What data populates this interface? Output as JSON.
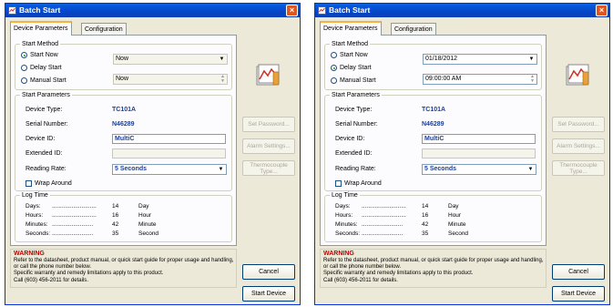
{
  "windows": [
    {
      "title": "Batch Start",
      "close_glyph": "×",
      "tabs": [
        "Device Parameters",
        "Configuration"
      ],
      "start_method": {
        "title": "Start Method",
        "options": [
          "Start Now",
          "Delay Start",
          "Manual Start"
        ],
        "selected": 0,
        "combo_value": "Now",
        "time_value": "Now"
      },
      "start_params": {
        "title": "Start Parameters",
        "device_type_label": "Device Type:",
        "device_type": "TC101A",
        "serial_label": "Serial Number:",
        "serial": "N46289",
        "device_id_label": "Device ID:",
        "device_id": "MultiC",
        "ext_id_label": "Extended ID:",
        "ext_id": "",
        "rate_label": "Reading Rate:",
        "rate": "5 Seconds",
        "wrap_label": "Wrap Around"
      },
      "log_time": {
        "title": "Log Time",
        "rows": [
          {
            "label": "Days:",
            "dots": "...........................",
            "value": "14",
            "unit": "Day"
          },
          {
            "label": "Hours:",
            "dots": "...........................",
            "value": "16",
            "unit": "Hour"
          },
          {
            "label": "Minutes:",
            "dots": ".........................",
            "value": "42",
            "unit": "Minute"
          },
          {
            "label": "Seconds:",
            "dots": ".........................",
            "value": "35",
            "unit": "Second"
          }
        ]
      },
      "side_buttons": [
        "Set Password...",
        "Alarm Settings...",
        "Thermocouple Type..."
      ],
      "warning_title": "WARNING",
      "warning_text": "Refer to the datasheet, product manual, or quick start guide for proper usage and handling, or call the phone number below.\nSpecific warranty and remedy limitations apply to this product.\nCall (603) 456-2011 for details.",
      "cancel": "Cancel",
      "start_device": "Start Device"
    },
    {
      "title": "Batch Start",
      "close_glyph": "×",
      "tabs": [
        "Device Parameters",
        "Configuration"
      ],
      "start_method": {
        "title": "Start Method",
        "options": [
          "Start Now",
          "Delay Start",
          "Manual Start"
        ],
        "selected": 1,
        "combo_value": "01/18/2012",
        "time_value": "09:00:00 AM"
      },
      "start_params": {
        "title": "Start Parameters",
        "device_type_label": "Device Type:",
        "device_type": "TC101A",
        "serial_label": "Serial Number:",
        "serial": "N46289",
        "device_id_label": "Device ID:",
        "device_id": "MultiC",
        "ext_id_label": "Extended ID:",
        "ext_id": "",
        "rate_label": "Reading Rate:",
        "rate": "5 Seconds",
        "wrap_label": "Wrap Around"
      },
      "log_time": {
        "title": "Log Time",
        "rows": [
          {
            "label": "Days:",
            "dots": "...........................",
            "value": "14",
            "unit": "Day"
          },
          {
            "label": "Hours:",
            "dots": "...........................",
            "value": "16",
            "unit": "Hour"
          },
          {
            "label": "Minutes:",
            "dots": ".........................",
            "value": "42",
            "unit": "Minute"
          },
          {
            "label": "Seconds:",
            "dots": ".........................",
            "value": "35",
            "unit": "Second"
          }
        ]
      },
      "side_buttons": [
        "Set Password...",
        "Alarm Settings...",
        "Thermocouple Type..."
      ],
      "warning_title": "WARNING",
      "warning_text": "Refer to the datasheet, product manual, or quick start guide for proper usage and handling, or call the phone number below.\nSpecific warranty and remedy limitations apply to this product.\nCall (603) 456-2011 for details.",
      "cancel": "Cancel",
      "start_device": "Start Device"
    }
  ]
}
